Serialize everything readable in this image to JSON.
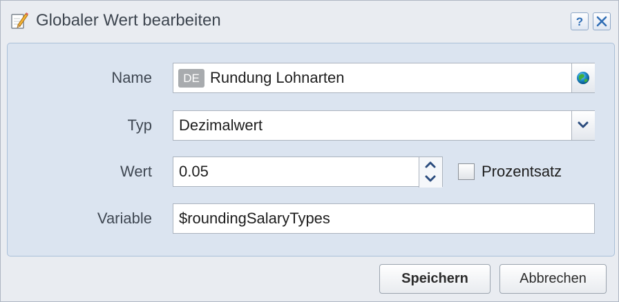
{
  "dialog": {
    "title": "Globaler Wert bearbeiten",
    "icons": {
      "title": "edit-pencil-icon",
      "help": "help-icon",
      "close": "close-icon"
    },
    "help_label": "?"
  },
  "form": {
    "name": {
      "label": "Name",
      "language_badge": "DE",
      "value": "Rundung Lohnarten",
      "icon": "globe-icon"
    },
    "type": {
      "label": "Typ",
      "value": "Dezimalwert",
      "icon": "chevron-down-icon"
    },
    "value": {
      "label": "Wert",
      "value": "0.05",
      "icons": [
        "arrow-up-icon",
        "arrow-down-icon"
      ]
    },
    "percentage": {
      "label": "Prozentsatz",
      "checked": false
    },
    "variable": {
      "label": "Variable",
      "value": "$roundingSalaryTypes"
    }
  },
  "buttons": {
    "save": "Speichern",
    "cancel": "Abbrechen"
  },
  "colors": {
    "panel_background": "#dbe4f0",
    "dialog_background": "#e9ecf1",
    "accent_border": "#a9bfd8"
  }
}
